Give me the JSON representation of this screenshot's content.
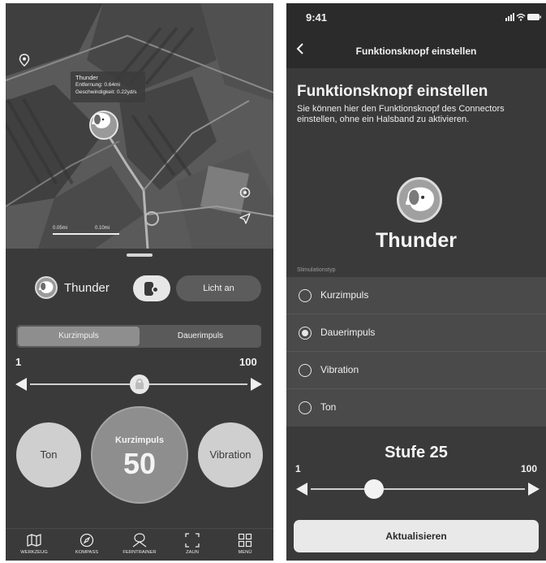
{
  "left": {
    "map": {
      "info_name": "Thunder",
      "info_distance": "Entfernung: 0.64mi",
      "info_speed": "Geschwindigkeit: 0.22yd/s",
      "scale_left": "0.05mi",
      "scale_right": "0.10mi"
    },
    "dog": {
      "name": "Thunder"
    },
    "light_button": "Licht an",
    "segments": [
      "Kurzimpuls",
      "Dauerimpuls"
    ],
    "active_segment": "Kurzimpuls",
    "slider": {
      "min": "1",
      "max": "100",
      "value_fraction": 0.52,
      "locked": true
    },
    "buttons": {
      "tone": "Ton",
      "main_label": "Kurzimpuls",
      "main_value": "50",
      "vibration": "Vibration"
    },
    "tabs": [
      {
        "label": "WERKZEUG",
        "icon": "map-icon"
      },
      {
        "label": "KOMPASS",
        "icon": "compass-icon"
      },
      {
        "label": "FERNTRAINER",
        "icon": "remote-trainer-icon"
      },
      {
        "label": "ZAUN",
        "icon": "fence-icon"
      },
      {
        "label": "MENÜ",
        "icon": "grid-menu-icon"
      }
    ]
  },
  "right": {
    "status_time": "9:41",
    "nav_title": "Funktionsknopf einstellen",
    "heading": "Funktionsknopf einstellen",
    "description": "Sie können hier den Funktionsknopf des Connectors einstellen, ohne ein Halsband zu aktivieren.",
    "dog_name": "Thunder",
    "stim_label": "Stimulationstyp",
    "options": [
      {
        "label": "Kurzimpuls",
        "selected": false
      },
      {
        "label": "Dauerimpuls",
        "selected": true
      },
      {
        "label": "Vibration",
        "selected": false
      },
      {
        "label": "Ton",
        "selected": false
      }
    ],
    "level_text": "Stufe 25",
    "slider": {
      "min": "1",
      "max": "100",
      "value": 25
    },
    "update_button": "Aktualisieren"
  }
}
